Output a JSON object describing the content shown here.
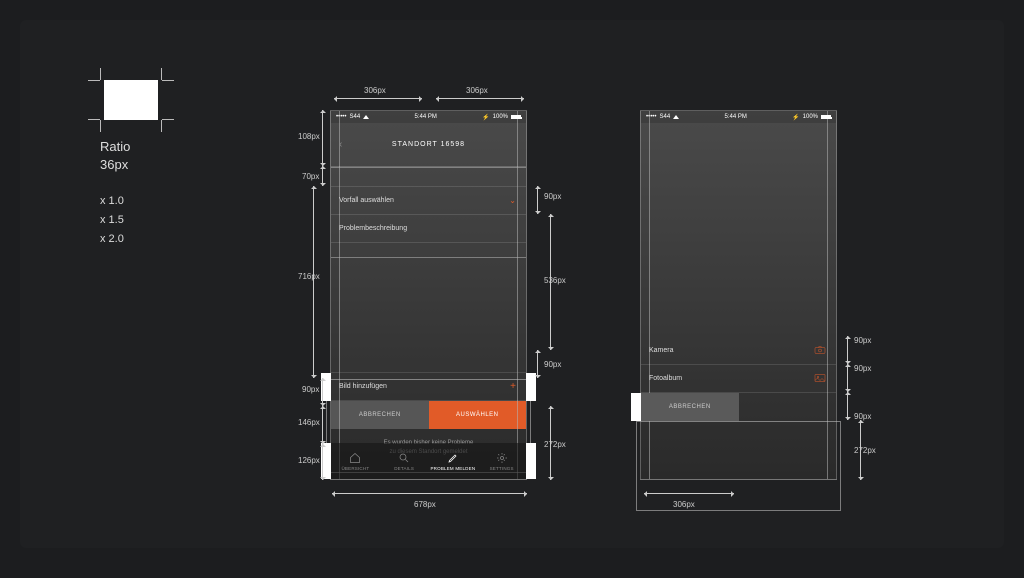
{
  "ratio": {
    "label_line1": "Ratio",
    "label_line2": "36px",
    "scales": [
      "x 1.0",
      "x 1.5",
      "x 2.0"
    ]
  },
  "statusbar": {
    "carrier": "S44",
    "dots": "•••••",
    "time": "5:44 PM",
    "battery": "100%"
  },
  "screen_left": {
    "title_prefix": "STANDORT",
    "title_id": "16598",
    "vorfall_row": "Vorfall auswählen",
    "beschreibung_row": "Problembeschreibung",
    "bild_row": "Bild hinzufügen",
    "btn_cancel": "ABBRECHEN",
    "btn_confirm": "AUSWÄHLEN",
    "info_line1": "Es wurden bisher keine Probleme",
    "info_line2": "zu diesem Standort gemeldet",
    "tabs": {
      "uebersicht": "ÜBERSICHT",
      "details": "DETAILS",
      "problem": "PROBLEM MELDEN",
      "settings": "SETTINGS"
    }
  },
  "screen_right": {
    "kamera_row": "Kamera",
    "fotoalbum_row": "Fotoalbum",
    "btn_cancel": "ABBRECHEN"
  },
  "dims": {
    "d678": "678px",
    "d306_l": "306px",
    "d306_r": "306px",
    "d306_r2": "306px",
    "d108": "108px",
    "d70": "70px",
    "d716": "716px",
    "d536": "536px",
    "d90_a": "90px",
    "d90_b": "90px",
    "d90_c": "90px",
    "d90_r1": "90px",
    "d90_r2": "90px",
    "d90_r3": "90px",
    "d146": "146px",
    "d126": "126px",
    "d272": "272px",
    "d272_r": "272px"
  }
}
